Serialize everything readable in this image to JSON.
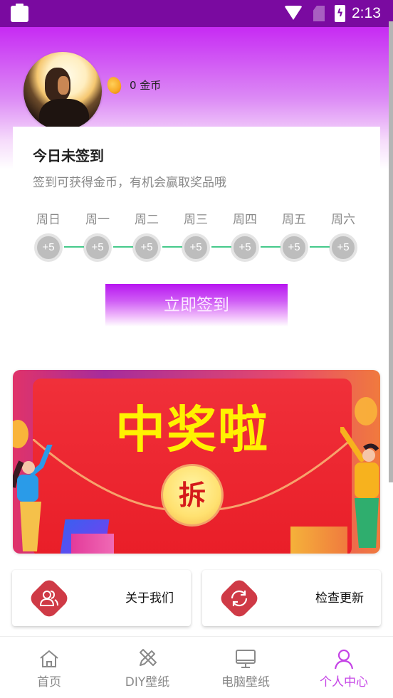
{
  "status_bar": {
    "time": "2:13",
    "icons": [
      "clipboard-icon",
      "wifi-icon",
      "no-sim-icon",
      "battery-charging-icon"
    ]
  },
  "profile": {
    "coins_value": "0",
    "coins_unit": "金币",
    "coins_text": "0 金币"
  },
  "signin": {
    "title": "今日未签到",
    "subtitle": "签到可获得金币，有机会赢取奖品哦",
    "days": [
      {
        "label": "周日",
        "reward": "+5"
      },
      {
        "label": "周一",
        "reward": "+5"
      },
      {
        "label": "周二",
        "reward": "+5"
      },
      {
        "label": "周三",
        "reward": "+5"
      },
      {
        "label": "周四",
        "reward": "+5"
      },
      {
        "label": "周五",
        "reward": "+5"
      },
      {
        "label": "周六",
        "reward": "+5"
      }
    ],
    "button_label": "立即签到"
  },
  "banner": {
    "title": "中奖啦",
    "seal_text": "拆"
  },
  "actions": [
    {
      "label": "关于我们",
      "icon": "users-icon"
    },
    {
      "label": "检查更新",
      "icon": "refresh-icon"
    }
  ],
  "bottom_nav": {
    "items": [
      {
        "label": "首页",
        "icon": "home-icon",
        "active": false
      },
      {
        "label": "DIY壁纸",
        "icon": "pencil-ruler-icon",
        "active": false
      },
      {
        "label": "电脑壁纸",
        "icon": "monitor-icon",
        "active": false
      },
      {
        "label": "个人中心",
        "icon": "user-icon",
        "active": true
      }
    ]
  },
  "colors": {
    "accent": "#c544e6",
    "status_bar": "#7a0aa0",
    "header_top": "#c72bf3",
    "connector": "#45c98a",
    "action_icon": "#cf3a46",
    "banner_title": "#fff200"
  }
}
